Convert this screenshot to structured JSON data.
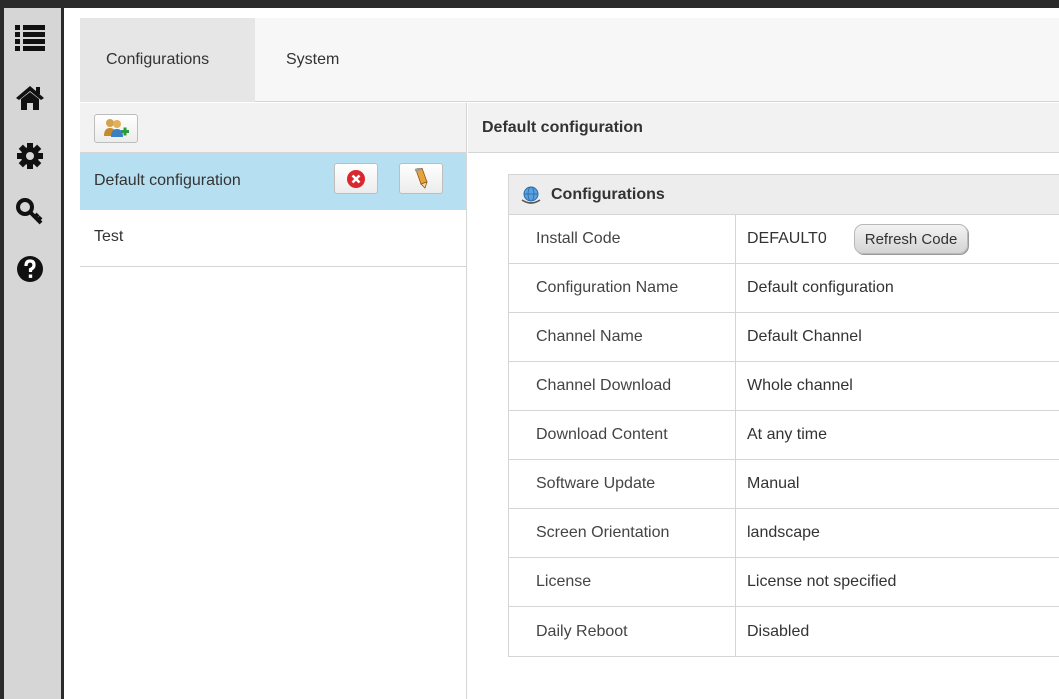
{
  "sidebar": {
    "icons": [
      "list-icon",
      "home-icon",
      "gear-icon",
      "key-icon",
      "help-icon"
    ]
  },
  "tabs": [
    {
      "label": "Configurations",
      "active": true
    },
    {
      "label": "System",
      "active": false
    }
  ],
  "left_panel": {
    "add_button_icon": "add-users-icon",
    "items": [
      {
        "label": "Default configuration",
        "selected": true
      },
      {
        "label": "Test",
        "selected": false
      }
    ]
  },
  "right_panel": {
    "header": "Default configuration",
    "section_title": "Configurations",
    "section_icon": "globe-icon",
    "rows": [
      {
        "label": "Install Code",
        "value": "DEFAULT0"
      },
      {
        "label": "Configuration Name",
        "value": "Default configuration"
      },
      {
        "label": "Channel Name",
        "value": "Default Channel"
      },
      {
        "label": "Channel Download",
        "value": "Whole channel"
      },
      {
        "label": "Download Content",
        "value": "At any time"
      },
      {
        "label": "Software Update",
        "value": "Manual"
      },
      {
        "label": "Screen Orientation",
        "value": "landscape"
      },
      {
        "label": "License",
        "value": "License not specified"
      },
      {
        "label": "Daily Reboot",
        "value": "Disabled"
      }
    ],
    "refresh_button": "Refresh Code"
  },
  "colors": {
    "selected_row": "#b7dff2",
    "sidebar_bg": "#d6d6d6",
    "frame": "#2b2b2b"
  }
}
